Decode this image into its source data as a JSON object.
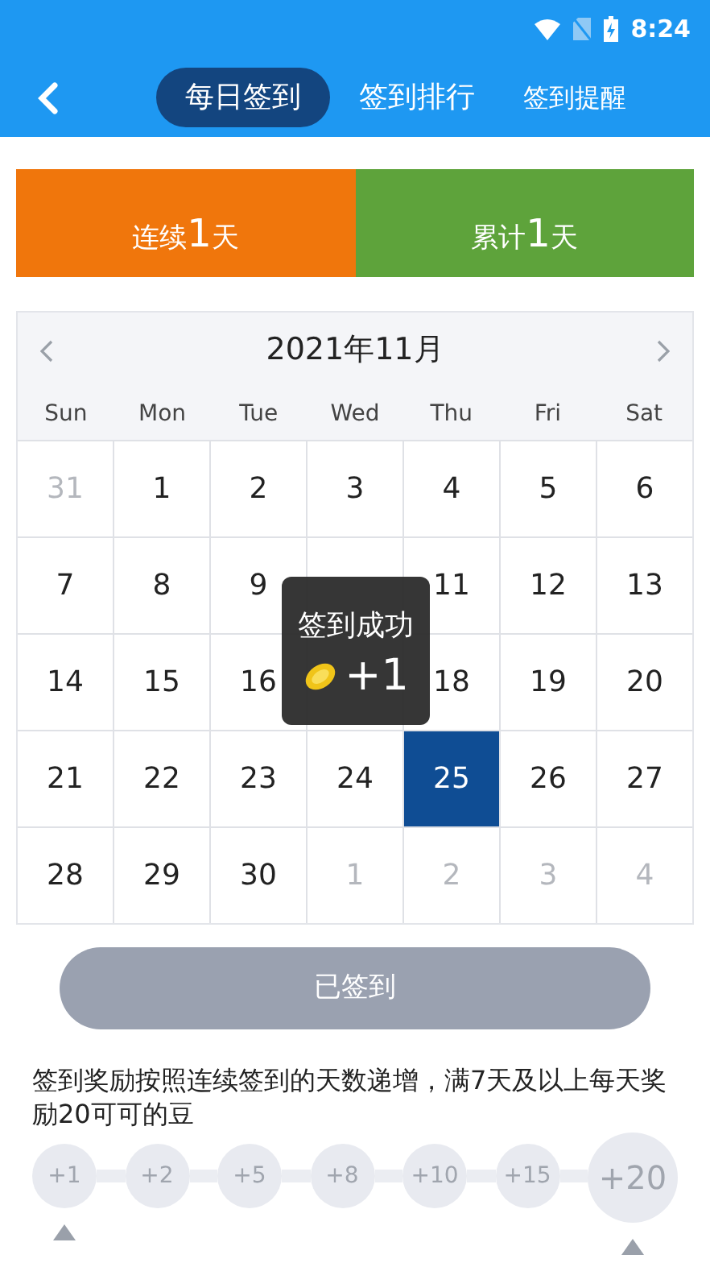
{
  "status_bar": {
    "time": "8:24"
  },
  "tabs": [
    {
      "label": "每日签到",
      "selected": true
    },
    {
      "label": "签到排行",
      "selected": false
    },
    {
      "label": "签到提醒",
      "selected": false
    }
  ],
  "stats": [
    {
      "prefix": "连续",
      "value": "1",
      "suffix": "天",
      "color": "#f0760c"
    },
    {
      "prefix": "累计",
      "value": "1",
      "suffix": "天",
      "color": "#5ea33b"
    }
  ],
  "calendar": {
    "month": "2021年11月",
    "weekdays": [
      "Sun",
      "Mon",
      "Tue",
      "Wed",
      "Thu",
      "Fri",
      "Sat"
    ],
    "days": [
      {
        "label": "31",
        "in_month": false,
        "selected": false
      },
      {
        "label": "1",
        "in_month": true,
        "selected": false
      },
      {
        "label": "2",
        "in_month": true,
        "selected": false
      },
      {
        "label": "3",
        "in_month": true,
        "selected": false
      },
      {
        "label": "4",
        "in_month": true,
        "selected": false
      },
      {
        "label": "5",
        "in_month": true,
        "selected": false
      },
      {
        "label": "6",
        "in_month": true,
        "selected": false
      },
      {
        "label": "7",
        "in_month": true,
        "selected": false
      },
      {
        "label": "8",
        "in_month": true,
        "selected": false
      },
      {
        "label": "9",
        "in_month": true,
        "selected": false
      },
      {
        "selected": false
      },
      {
        "label": "11",
        "in_month": true,
        "selected": false
      },
      {
        "label": "12",
        "in_month": true,
        "selected": false
      },
      {
        "label": "13",
        "in_month": true,
        "selected": false
      },
      {
        "label": "14",
        "in_month": true,
        "selected": false
      },
      {
        "label": "15",
        "in_month": true,
        "selected": false
      },
      {
        "label": "16",
        "in_month": true,
        "selected": false
      },
      {
        "selected": false
      },
      {
        "label": "18",
        "in_month": true,
        "selected": false
      },
      {
        "label": "19",
        "in_month": true,
        "selected": false
      },
      {
        "label": "20",
        "in_month": true,
        "selected": false
      },
      {
        "label": "21",
        "in_month": true,
        "selected": false
      },
      {
        "label": "22",
        "in_month": true,
        "selected": false
      },
      {
        "label": "23",
        "in_month": true,
        "selected": false
      },
      {
        "label": "24",
        "in_month": true,
        "selected": false
      },
      {
        "label": "25",
        "in_month": true,
        "selected": true
      },
      {
        "label": "26",
        "in_month": true,
        "selected": false
      },
      {
        "label": "27",
        "in_month": true,
        "selected": false
      },
      {
        "label": "28",
        "in_month": true,
        "selected": false
      },
      {
        "label": "29",
        "in_month": true,
        "selected": false
      },
      {
        "label": "30",
        "in_month": true,
        "selected": false
      },
      {
        "label": "1",
        "in_month": false,
        "selected": false
      },
      {
        "label": "2",
        "in_month": false,
        "selected": false
      },
      {
        "label": "3",
        "in_month": false,
        "selected": false
      },
      {
        "label": "4",
        "in_month": false,
        "selected": false
      }
    ]
  },
  "toast": {
    "title": "签到成功",
    "reward": "+1"
  },
  "checkin_button": {
    "label": "已签到",
    "disabled": true
  },
  "rules_text": "签到奖励按照连续签到的天数递增，满7天及以上每天奖励20可可的豆",
  "reward_steps": [
    {
      "label": "+1",
      "marker": true,
      "final": false
    },
    {
      "label": "+2",
      "marker": false,
      "final": false
    },
    {
      "label": "+5",
      "marker": false,
      "final": false
    },
    {
      "label": "+8",
      "marker": false,
      "final": false
    },
    {
      "label": "+10",
      "marker": false,
      "final": false
    },
    {
      "label": "+15",
      "marker": false,
      "final": false
    },
    {
      "label": "+20",
      "marker": true,
      "final": true
    }
  ]
}
